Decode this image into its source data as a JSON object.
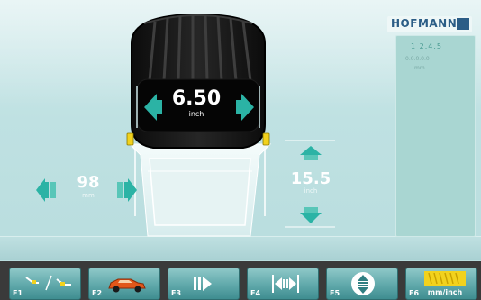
{
  "brand": {
    "name": "HOFMANN"
  },
  "tire": {
    "width_value": "6.50",
    "width_unit": "inch",
    "distance_value": "98",
    "distance_unit": "mm",
    "diameter_value": "15.5",
    "diameter_unit": "inch"
  },
  "info_panel": {
    "values": "1  2.4.5",
    "row1": "0.0.0.0.0",
    "row2": "mm"
  },
  "function_keys": [
    {
      "key": "F1",
      "icon": "weight-placement-icon"
    },
    {
      "key": "F2",
      "icon": "car-icon"
    },
    {
      "key": "F3",
      "icon": "arrow-right-icon"
    },
    {
      "key": "F4",
      "icon": "width-arrows-icon"
    },
    {
      "key": "F5",
      "icon": "diameter-arrows-icon"
    },
    {
      "key": "F6",
      "icon": "unit-toggle-icon",
      "label": "mm/inch"
    }
  ],
  "colors": {
    "arrow": "#2bb3a5",
    "badge": "#f2d21d",
    "background": "#c6e4e5"
  }
}
